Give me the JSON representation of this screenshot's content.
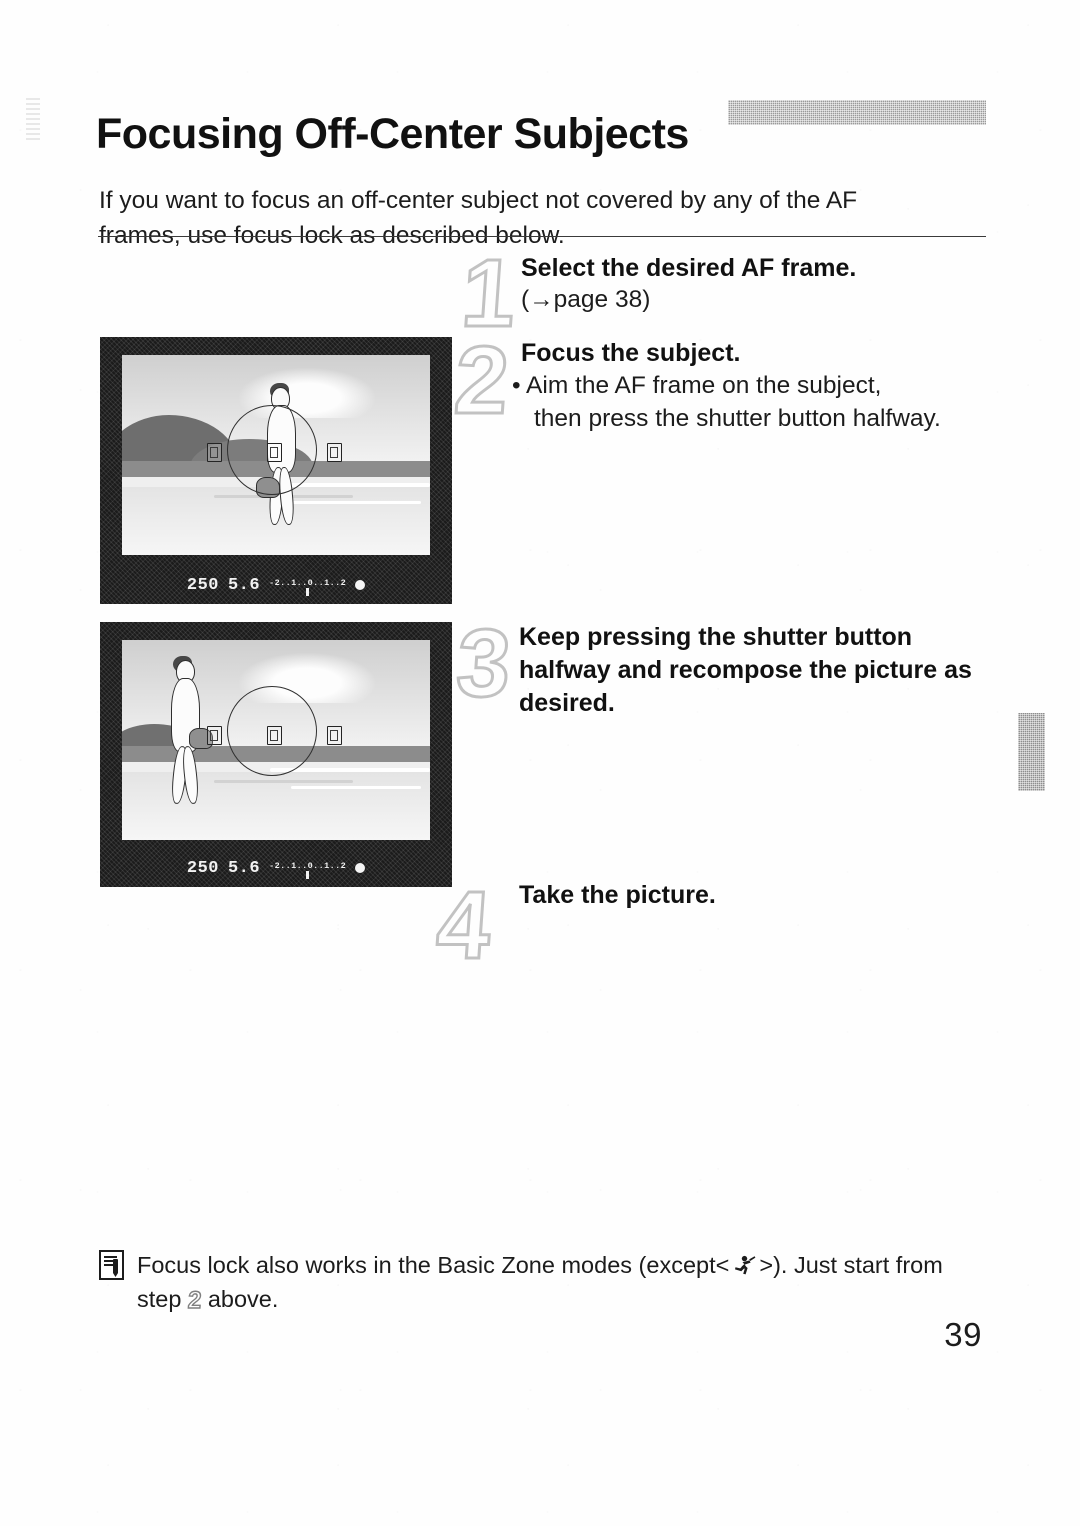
{
  "page": {
    "title": "Focusing Off-Center Subjects",
    "intro": "If you want to focus an off-center subject not covered by any of the AF frames, use focus lock as described below.",
    "page_number": "39"
  },
  "steps": [
    {
      "number": "1",
      "heading": "Select the desired AF frame.",
      "body": "(→page 38)"
    },
    {
      "number": "2",
      "heading": "Focus the subject.",
      "bullet": "• Aim the AF frame on the subject,",
      "bullet_cont": "then press the shutter button halfway."
    },
    {
      "number": "3",
      "heading": "Keep pressing the shutter button halfway and recompose the picture as desired."
    },
    {
      "number": "4",
      "heading": "Take the picture."
    }
  ],
  "figures": [
    {
      "caption_role": "viewfinder-subject-centered",
      "readout": {
        "shutter_speed": "250",
        "aperture": "5.6",
        "exposure_scale": "-2..1..0..1..2",
        "focus_confirm": "●"
      }
    },
    {
      "caption_role": "viewfinder-recomposed",
      "readout": {
        "shutter_speed": "250",
        "aperture": "5.6",
        "exposure_scale": "-2..1..0..1..2",
        "focus_confirm": "●"
      }
    }
  ],
  "note": {
    "icon": "note-icon",
    "text_before": "Focus lock also works in the Basic Zone modes (except<",
    "mode_icon": "sports-mode-icon",
    "text_after": ">). Just start from",
    "line2_before": "step",
    "line2_number": "2",
    "line2_after": "above."
  },
  "colors": {
    "text": "#1c1c1c",
    "title_bar": "#9a9a9a",
    "step_number_outline": "#c2c2c2",
    "thumb_tab": "#8e8e8e"
  }
}
